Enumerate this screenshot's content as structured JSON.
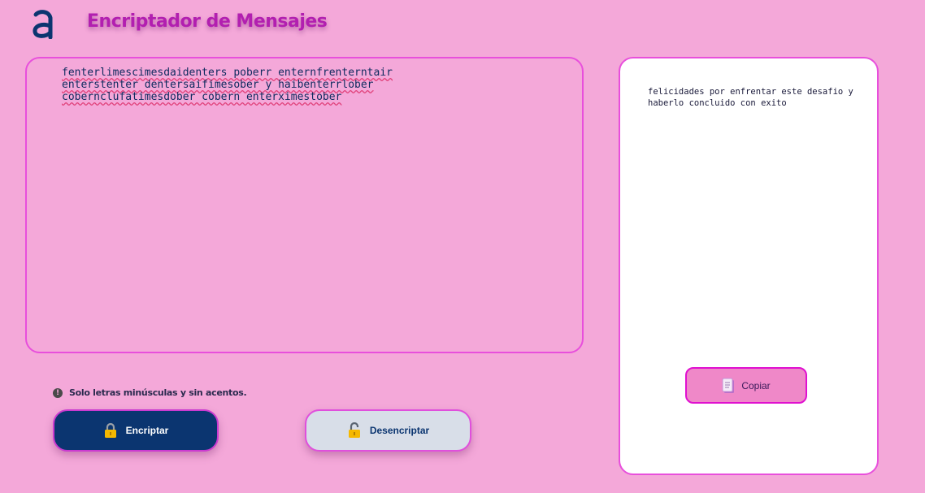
{
  "header": {
    "title": "Encriptador de Mensajes",
    "logo_icon": "alura-a-logo-icon"
  },
  "editor": {
    "text": "fenterlimescimesdaidenters poberr enternfrenterntair enterstenter dentersaifimesober y haibenterrlober cobernclufatimesdober cobern enterximestober"
  },
  "hint": {
    "icon": "info-icon",
    "text": "Solo letras minúsculas y sin acentos."
  },
  "buttons": {
    "encrypt_label": "Encriptar",
    "encrypt_icon": "lock-closed-icon",
    "decrypt_label": "Desencriptar",
    "decrypt_icon": "lock-open-icon"
  },
  "output": {
    "text": "felicidades por enfrentar este desafio y haberlo concluido con exito",
    "copy_label": "Copiar",
    "copy_icon": "document-icon"
  },
  "colors": {
    "background": "#f4a8d9",
    "title": "#b21fb0",
    "primary": "#0b3570",
    "border_accent": "#e84fdc"
  }
}
